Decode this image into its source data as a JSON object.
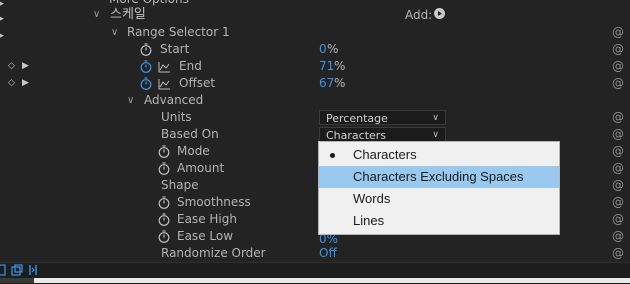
{
  "header": {
    "more_options": "More Options",
    "korean_label": "스케일",
    "add_label": "Add:"
  },
  "range_selector": {
    "title": "Range Selector 1",
    "start_label": "Start",
    "start_value": "0",
    "end_label": "End",
    "end_value": "71",
    "offset_label": "Offset",
    "offset_value": "67",
    "percent": "%"
  },
  "advanced": {
    "title": "Advanced",
    "units_label": "Units",
    "units_value": "Percentage",
    "based_on_label": "Based On",
    "based_on_value": "Characters",
    "mode_label": "Mode",
    "amount_label": "Amount",
    "shape_label": "Shape",
    "smoothness_label": "Smoothness",
    "ease_high_label": "Ease High",
    "ease_low_label": "Ease Low",
    "ease_low_value_partial": "0%",
    "randomize_label": "Randomize Order",
    "randomize_value": "Off"
  },
  "dropdown_menu": {
    "items": [
      {
        "label": "Characters",
        "selected": true
      },
      {
        "label": "Characters Excluding Spaces",
        "highlighted": true
      },
      {
        "label": "Words"
      },
      {
        "label": "Lines"
      }
    ]
  },
  "colors": {
    "background": "#232323",
    "value_blue": "#3b93e8",
    "menu_highlight": "#99c9ef"
  },
  "icons": [
    "stopwatch-icon",
    "graph-icon",
    "keyframe-nav-icon",
    "pickwhip-spiral-icon",
    "chevron-down-icon",
    "play-triangle-icon"
  ]
}
